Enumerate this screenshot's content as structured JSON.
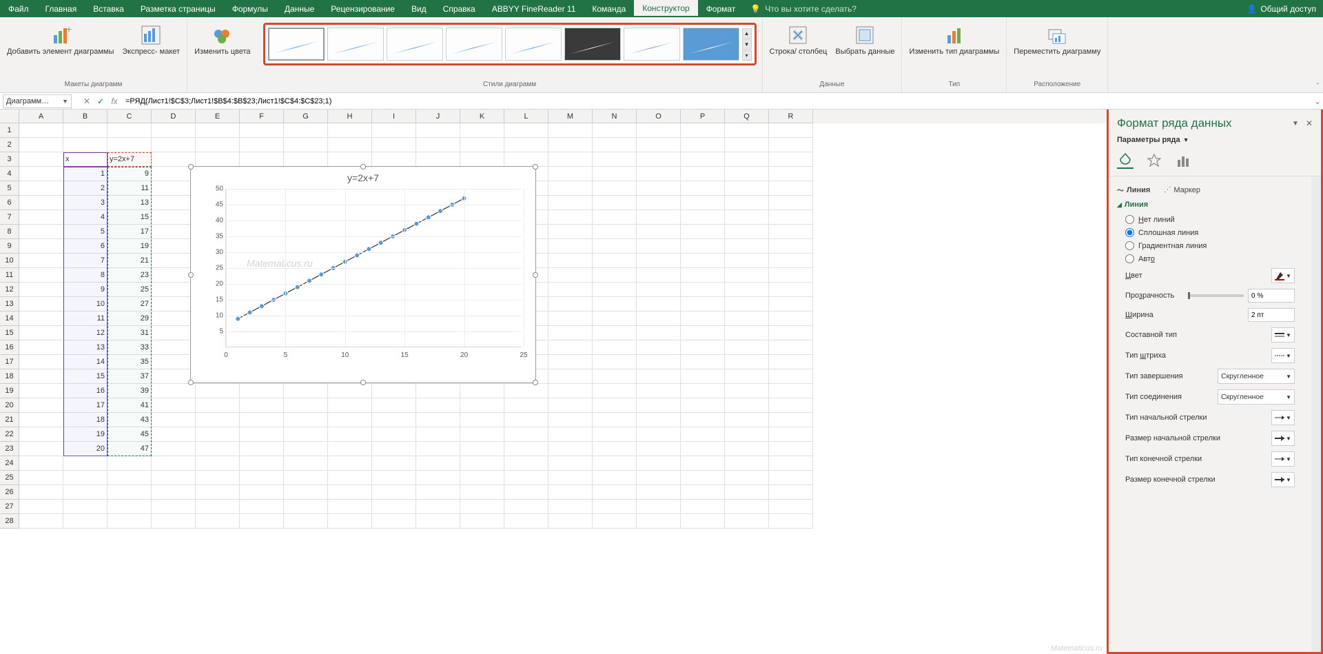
{
  "tabs": [
    "Файл",
    "Главная",
    "Вставка",
    "Разметка страницы",
    "Формулы",
    "Данные",
    "Рецензирование",
    "Вид",
    "Справка",
    "ABBYY FineReader 11",
    "Команда",
    "Конструктор",
    "Формат"
  ],
  "active_tab": 11,
  "tell_me": "Что вы хотите сделать?",
  "share": "Общий доступ",
  "ribbon": {
    "add_element": "Добавить элемент\nдиаграммы",
    "quick_layout": "Экспресс-\nмакет",
    "change_colors": "Изменить\nцвета",
    "group_layouts": "Макеты диаграмм",
    "group_styles": "Стили диаграмм",
    "switch_rowcol": "Строка/\nстолбец",
    "select_data": "Выбрать\nданные",
    "group_data": "Данные",
    "change_type": "Изменить тип\nдиаграммы",
    "group_type": "Тип",
    "move_chart": "Переместить\nдиаграмму",
    "group_location": "Расположение"
  },
  "name_box": "Диаграмм…",
  "formula": "=РЯД(Лист1!$C$3;Лист1!$B$4:$B$23;Лист1!$C$4:$C$23;1)",
  "columns": [
    "A",
    "B",
    "C",
    "D",
    "E",
    "F",
    "G",
    "H",
    "I",
    "J",
    "K",
    "L",
    "M",
    "N",
    "O",
    "P",
    "Q",
    "R"
  ],
  "row_count": 28,
  "table": {
    "header_b": "x",
    "header_c": "y=2x+7",
    "rows": [
      {
        "b": "1",
        "c": "9"
      },
      {
        "b": "2",
        "c": "11"
      },
      {
        "b": "3",
        "c": "13"
      },
      {
        "b": "4",
        "c": "15"
      },
      {
        "b": "5",
        "c": "17"
      },
      {
        "b": "6",
        "c": "19"
      },
      {
        "b": "7",
        "c": "21"
      },
      {
        "b": "8",
        "c": "23"
      },
      {
        "b": "9",
        "c": "25"
      },
      {
        "b": "10",
        "c": "27"
      },
      {
        "b": "11",
        "c": "29"
      },
      {
        "b": "12",
        "c": "31"
      },
      {
        "b": "13",
        "c": "33"
      },
      {
        "b": "14",
        "c": "35"
      },
      {
        "b": "15",
        "c": "37"
      },
      {
        "b": "16",
        "c": "39"
      },
      {
        "b": "17",
        "c": "41"
      },
      {
        "b": "18",
        "c": "43"
      },
      {
        "b": "19",
        "c": "45"
      },
      {
        "b": "20",
        "c": "47"
      }
    ]
  },
  "chart_data": {
    "type": "line",
    "title": "y=2x+7",
    "x": [
      1,
      2,
      3,
      4,
      5,
      6,
      7,
      8,
      9,
      10,
      11,
      12,
      13,
      14,
      15,
      16,
      17,
      18,
      19,
      20
    ],
    "y": [
      9,
      11,
      13,
      15,
      17,
      19,
      21,
      23,
      25,
      27,
      29,
      31,
      33,
      35,
      37,
      39,
      41,
      43,
      45,
      47
    ],
    "xticks": [
      0,
      5,
      10,
      15,
      20,
      25
    ],
    "yticks": [
      5,
      10,
      15,
      20,
      25,
      30,
      35,
      40,
      45,
      50
    ],
    "xlim": [
      0,
      25
    ],
    "ylim": [
      0,
      50
    ]
  },
  "watermark": "Matematicus.ru",
  "format_pane": {
    "title": "Формат ряда данных",
    "subtitle": "Параметры ряда",
    "tab_line": "Линия",
    "tab_marker": "Маркер",
    "section_line": "Линия",
    "opt_none": "Нет линий",
    "opt_solid": "Сплошная линия",
    "opt_gradient": "Градиентная линия",
    "opt_auto": "Авто",
    "color": "Цвет",
    "transparency": "Прозрачность",
    "transparency_val": "0 %",
    "width": "Ширина",
    "width_val": "2 пт",
    "compound": "Составной тип",
    "dash": "Тип штриха",
    "cap": "Тип завершения",
    "cap_val": "Скругленное",
    "join": "Тип соединения",
    "join_val": "Скругленное",
    "begin_arrow_type": "Тип начальной стрелки",
    "begin_arrow_size": "Размер начальной стрелки",
    "end_arrow_type": "Тип конечной стрелки",
    "end_arrow_size": "Размер конечной стрелки"
  }
}
